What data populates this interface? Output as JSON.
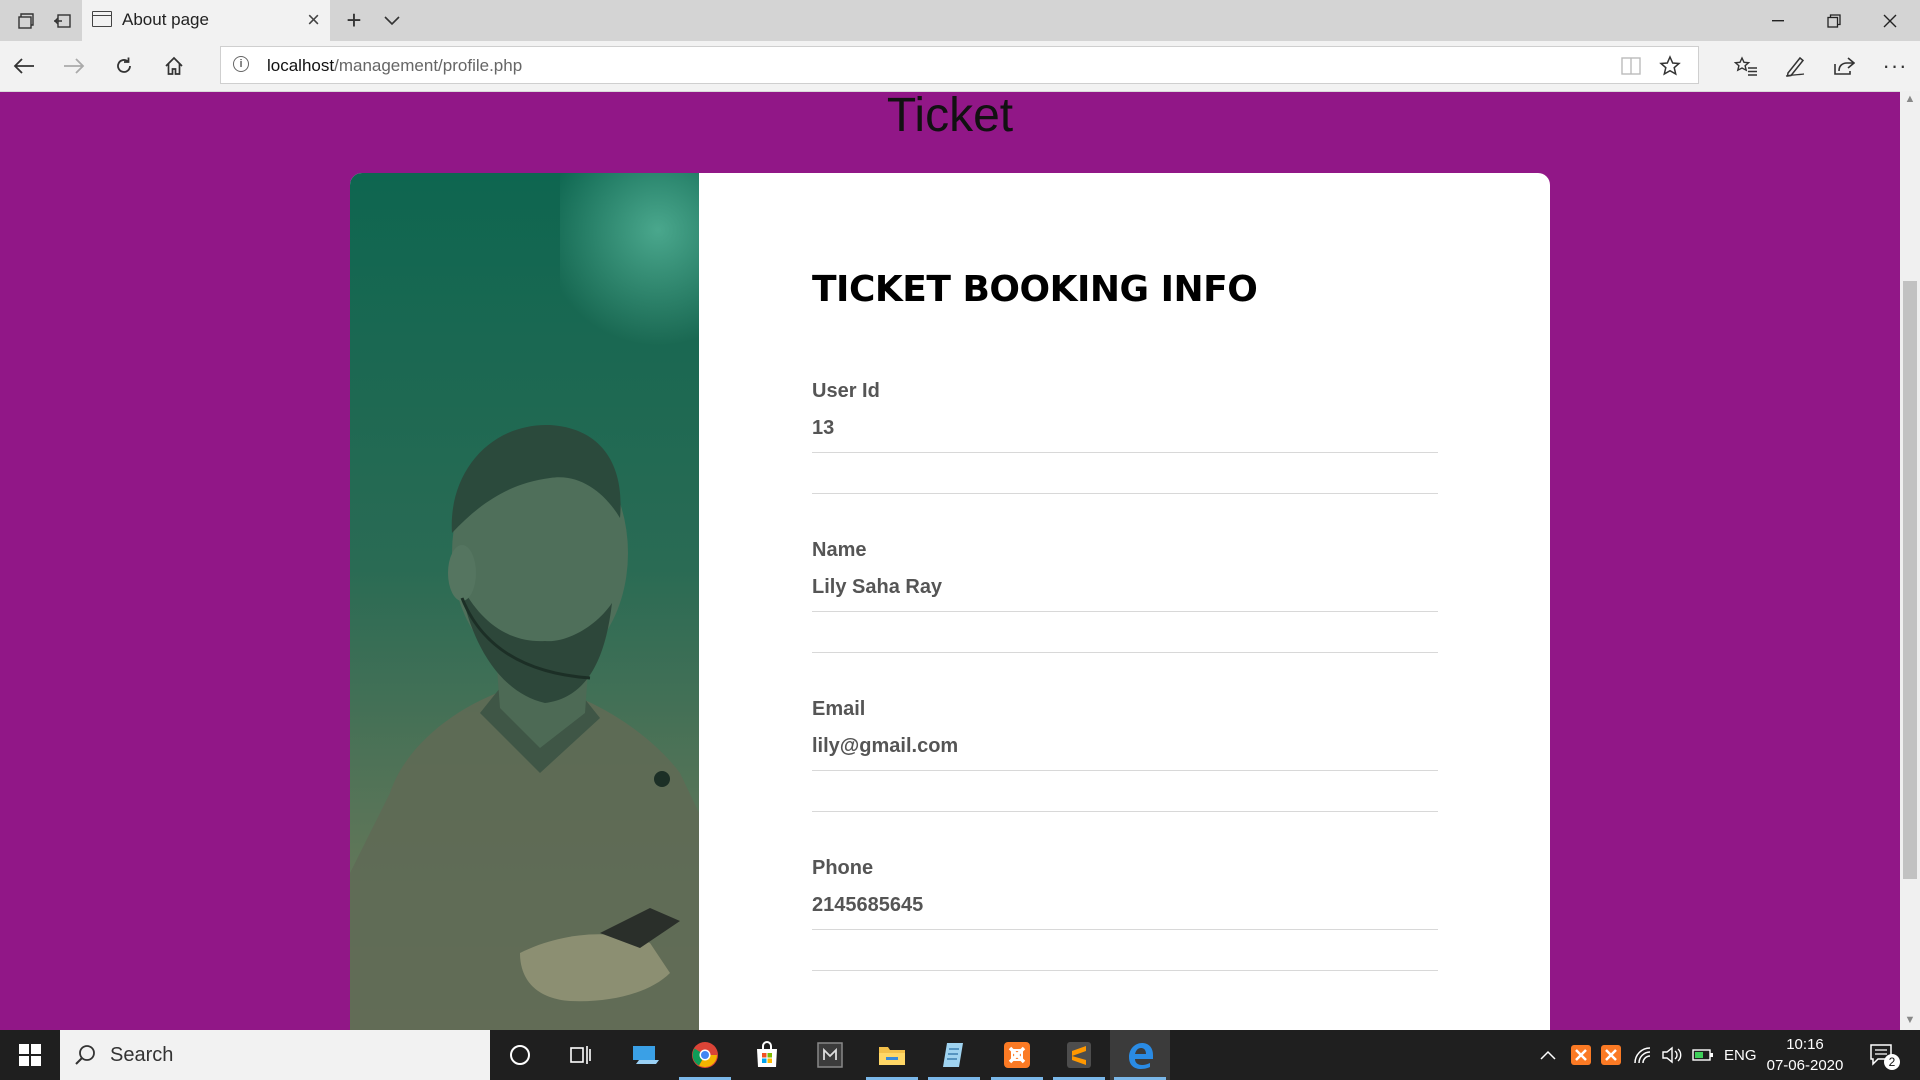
{
  "browser": {
    "tab_title": "About page",
    "url_host": "localhost",
    "url_path": "/management/profile.php"
  },
  "page": {
    "title": "Ticket",
    "heading": "TICKET BOOKING INFO",
    "fields": [
      {
        "label": "User Id",
        "value": "13"
      },
      {
        "label": "Name",
        "value": "Lily Saha Ray"
      },
      {
        "label": "Email",
        "value": "lily@gmail.com"
      },
      {
        "label": "Phone",
        "value": "2145685645"
      }
    ]
  },
  "taskbar": {
    "search_placeholder": "Search",
    "language": "ENG",
    "time": "10:16",
    "date": "07-06-2020",
    "notifications": "2"
  },
  "colors": {
    "page_background": "#911787",
    "card_background": "#ffffff",
    "photo_tint": "#0e6650"
  }
}
